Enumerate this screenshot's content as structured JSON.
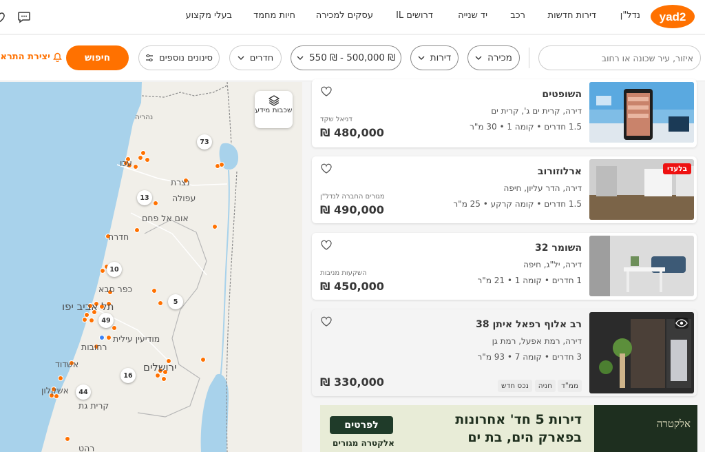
{
  "brand": {
    "logo_text": "yad2",
    "accent": "#ff7100"
  },
  "nav": {
    "items": [
      "נדל\"ן",
      "דירות חדשות",
      "רכב",
      "יד שנייה",
      "דרושים IL",
      "עסקים למכירה",
      "חיות מחמד",
      "בעלי מקצוע"
    ]
  },
  "filters": {
    "search_placeholder": "איזור, עיר שכונה או רחוב",
    "deal_type": "מכירה",
    "property_type": "דירות",
    "price_range": "550 ₪ - 500,000 ₪",
    "rooms": "חדרים",
    "more_filters": "סינונים נוספים",
    "search_button": "חיפוש",
    "create_alert": "יצירת התראה"
  },
  "map": {
    "layers_label": "שכבות מידע",
    "labels": {
      "nahariya": "נהריה",
      "akko": "עכו",
      "nazareth": "נצרת",
      "afula": "עפולה",
      "um_al_fahm": "אום אל פחם",
      "hadera": "חדרה",
      "kfar_saba": "כפר סבא",
      "tel_aviv": "תל אביב יפו",
      "modiin": "מודיעין עילית",
      "rehovot": "רחובות",
      "ashdod": "אשדוד",
      "jerusalem": "ירושלים",
      "ashkelon": "אשקלון",
      "kiryat_gat": "קרית גת",
      "rahat": "רהט"
    },
    "clusters": [
      "73",
      "13",
      "10",
      "5",
      "49",
      "16",
      "44"
    ]
  },
  "listings": [
    {
      "title": "השופטים",
      "subtitle": "דירה, קרית ים ג', קרית ים",
      "meta": "1.5 חדרים • קומה 1 • 30 מ\"ר",
      "agency": "דניאל שקד",
      "price": "480,000 ₪"
    },
    {
      "title": "ארלוזורוב",
      "subtitle": "דירה, הדר עליון, חיפה",
      "meta": "1.5 חדרים • קומה קרקע • 25 מ\"ר",
      "agency": "מגורים החברה לנדל\"ן",
      "price": "490,000 ₪",
      "badge": "בלעדי"
    },
    {
      "title": "השומר 32",
      "subtitle": "דירה, יל\"ג, חיפה",
      "meta": "1 חדרים • קומה 1 • 21 מ\"ר",
      "agency": "השקעות מניבות",
      "price": "450,000 ₪"
    },
    {
      "title": "רב אלוף רפאל איתן 38",
      "subtitle": "דירה, רמת אפעל, רמת גן",
      "meta": "3 חדרים • קומה 7 • 93 מ\"ר",
      "price": "330,000 ₪",
      "tags": [
        "ממ\"ד",
        "חניה",
        "נכס חדש"
      ]
    }
  ],
  "banner": {
    "headline_1": "דירות 5 חד' אחרונות",
    "headline_2": "בפארק הים, בת ים",
    "cta": "לפרטים",
    "brand": "אלקטרה מגורים",
    "logo": "אלקטרה"
  }
}
